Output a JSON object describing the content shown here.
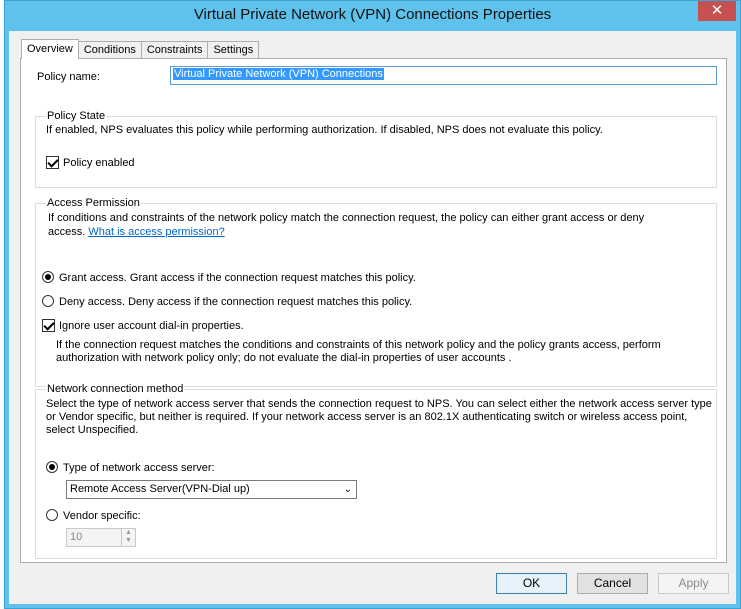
{
  "window": {
    "title": "Virtual Private Network (VPN) Connections Properties",
    "close_glyph": "✕"
  },
  "tabs": [
    {
      "label": "Overview",
      "active": true
    },
    {
      "label": "Conditions",
      "active": false
    },
    {
      "label": "Constraints",
      "active": false
    },
    {
      "label": "Settings",
      "active": false
    }
  ],
  "policy_name": {
    "label": "Policy name:",
    "value": "Virtual Private Network (VPN) Connections"
  },
  "policy_state": {
    "title": "Policy State",
    "description": "If enabled, NPS evaluates this policy while performing authorization. If disabled, NPS does not evaluate this policy.",
    "enabled_label": "Policy enabled",
    "enabled": true
  },
  "access_permission": {
    "title": "Access Permission",
    "description_line1": "If conditions and constraints of the network policy match the connection request, the policy can either grant access or deny",
    "description_line2": "access.",
    "link_text": "What is access permission?",
    "grant_label": "Grant access. Grant access if the connection request matches this policy.",
    "deny_label": "Deny access. Deny access if the connection request matches this policy.",
    "selected": "grant",
    "ignore_label": "Ignore user account dial-in properties.",
    "ignore_checked": true,
    "ignore_desc_line1": "If the connection request matches the conditions and constraints of this network policy and the policy grants access, perform",
    "ignore_desc_line2": "authorization with network policy only; do not evaluate the dial-in properties of user accounts ."
  },
  "network_method": {
    "title": "Network connection method",
    "desc_line1": "Select the type of network access server that sends the connection request to NPS. You can select either the network access server type",
    "desc_line2": "or Vendor specific, but neither is required.  If your network access server is an 802.1X authenticating switch or wireless access point,",
    "desc_line3": "select Unspecified.",
    "type_label": "Type of network access server:",
    "type_selected_value": "Remote Access Server(VPN-Dial up)",
    "vendor_label": "Vendor specific:",
    "vendor_value": "10",
    "selected": "type"
  },
  "buttons": {
    "ok": "OK",
    "cancel": "Cancel",
    "apply": "Apply"
  },
  "colors": {
    "title_bar": "#5fc2ec",
    "close_button": "#c75050",
    "link": "#0066cc"
  },
  "icons": {
    "dropdown": "chevron-down-icon",
    "spin_up": "chevron-up-icon",
    "spin_down": "chevron-down-icon"
  }
}
